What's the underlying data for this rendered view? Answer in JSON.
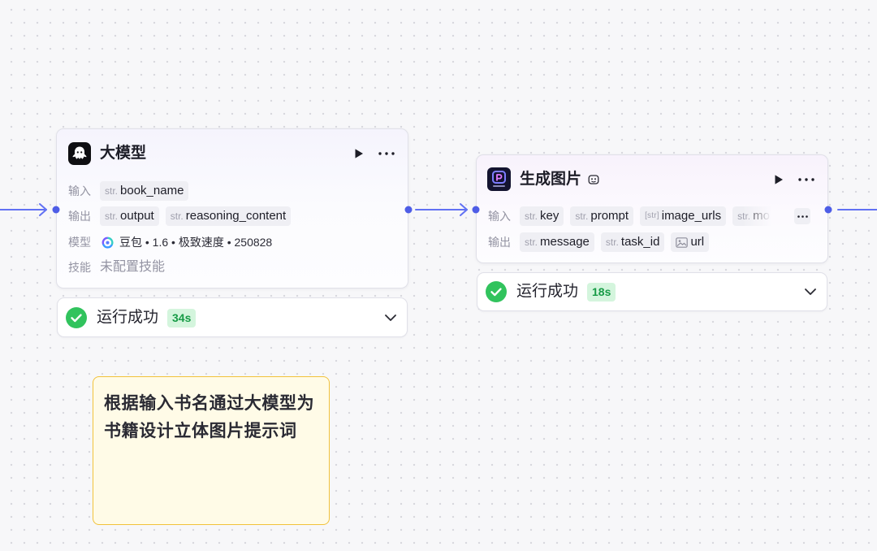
{
  "theme": {
    "canvas_bg": "#f7f7f9",
    "grid_dot": "#d5d5dc",
    "edge": "#6171f3",
    "port": "#4e5de6",
    "node_border": "#e0e0e8",
    "tag_bg": "#efeff4",
    "text_main": "#1d1d27",
    "text_muted": "#9393a2",
    "success": "#31c35d",
    "badge_bg": "#d4f5dd",
    "badge_text": "#179b46",
    "note_bg": "#fffbe7",
    "note_border": "#f2c23a"
  },
  "nodes": [
    {
      "icon": "llm-ghost-icon",
      "title": "大模型",
      "run_icon": "play-icon",
      "menu_icon": "more-icon",
      "input_label": "输入",
      "inputs": [
        {
          "type": "str.",
          "name": "book_name"
        }
      ],
      "output_label": "输出",
      "outputs": [
        {
          "type": "str.",
          "name": "output"
        },
        {
          "type": "str.",
          "name": "reasoning_content"
        }
      ],
      "model_label": "模型",
      "model_icon": "doubao-icon",
      "model_value": "豆包 • 1.6 • 极致速度 • 250828",
      "skill_label": "技能",
      "skill_value": "未配置技能",
      "status": {
        "icon": "check-circle-icon",
        "text": "运行成功",
        "duration": "34s",
        "toggle_icon": "chevron-down-icon"
      }
    },
    {
      "icon": "image-generation-plugin-icon",
      "title": "生成图片",
      "title_badge_icon": "plugin-badge-icon",
      "run_icon": "play-icon",
      "menu_icon": "more-icon",
      "input_label": "输入",
      "inputs": [
        {
          "type": "str.",
          "name": "key"
        },
        {
          "type": "str.",
          "name": "prompt"
        },
        {
          "type": "[str]",
          "name": "image_urls"
        },
        {
          "type": "str.",
          "name": "mo"
        }
      ],
      "inputs_overflow_icon": "more-icon",
      "output_label": "输出",
      "outputs": [
        {
          "type": "str.",
          "name": "message"
        },
        {
          "type": "str.",
          "name": "task_id"
        },
        {
          "type_icon": "image-type-icon",
          "name": "url"
        }
      ],
      "status": {
        "icon": "check-circle-icon",
        "text": "运行成功",
        "duration": "18s",
        "toggle_icon": "chevron-down-icon"
      }
    }
  ],
  "note": {
    "lines": [
      "根据输入书名通过大模型为",
      "书籍设计立体图片提示词"
    ]
  }
}
